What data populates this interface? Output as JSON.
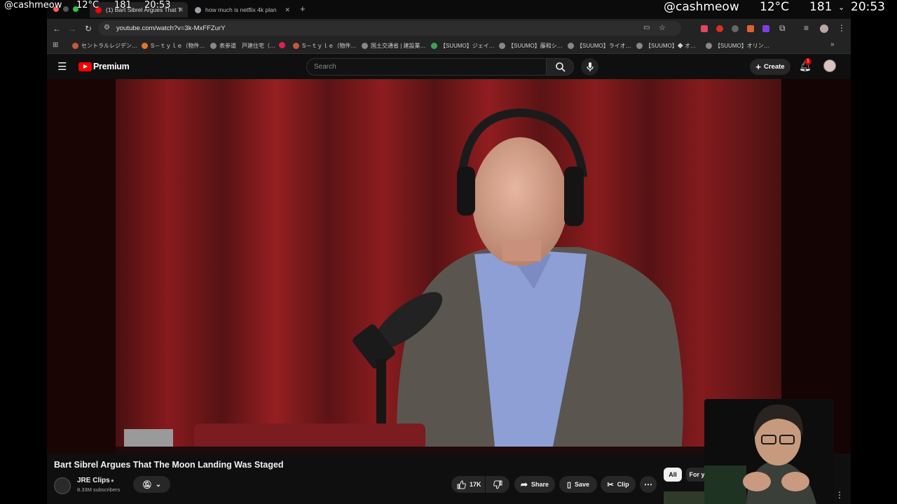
{
  "overlay": {
    "handle_left": "@cashmeow",
    "temp_left": "12°C",
    "count_left": "181",
    "time_left": "20:53",
    "handle_right": "@cashmeow",
    "temp_right": "12°C",
    "count_right": "181",
    "time_right": "20:53"
  },
  "tabs": [
    {
      "title": "(1) Bart Sibrel Argues That T",
      "active": true,
      "icon_color": "#ff0000"
    },
    {
      "title": "how much is netflix 4k plan",
      "active": false,
      "icon_color": "#9aa0a6"
    }
  ],
  "toolbar": {
    "url": "youtube.com/watch?v=3k-MxFFZurY"
  },
  "bookmarks": [
    {
      "label": "セントラルレジデン…",
      "icon_color": "#c05a3a"
    },
    {
      "label": "S－ｔｙｌｅ（物件…",
      "icon_color": "#e0762b"
    },
    {
      "label": "表参道　戸建住宅（…",
      "icon_color": "#888888"
    },
    {
      "label": "",
      "icon_color": "#e02050"
    },
    {
      "label": "S－ｔｙｌｅ（物件…",
      "icon_color": "#c05a3a"
    },
    {
      "label": "国土交通省 | 建設業…",
      "icon_color": "#888888"
    },
    {
      "label": "【SUUMO】ジェイ…",
      "icon_color": "#3fa34d"
    },
    {
      "label": "【SUUMO】藤和シ…",
      "icon_color": "#888888"
    },
    {
      "label": "【SUUMO】ライオ…",
      "icon_color": "#888888"
    },
    {
      "label": "【SUUMO】◆ オ…",
      "icon_color": "#888888"
    },
    {
      "label": "【SUUMO】オリン…",
      "icon_color": "#888888"
    }
  ],
  "youtube": {
    "logo_text": "Premium",
    "search_placeholder": "Search",
    "create_label": "Create",
    "notification_count": "1"
  },
  "video": {
    "title": "Bart Sibrel Argues That The Moon Landing Was Staged",
    "channel": "JRE Clips",
    "subscribers": "8.33M subscribers",
    "likes": "17K",
    "share_label": "Share",
    "save_label": "Save",
    "clip_label": "Clip"
  },
  "chips": {
    "all": "All",
    "for_you": "For you"
  },
  "icons": {
    "menu": "hamburger-menu-icon",
    "search": "search-icon",
    "mic": "microphone-icon",
    "bell": "bell-icon",
    "like": "thumbs-up-icon",
    "dislike": "thumbs-down-icon",
    "share": "share-arrow-icon",
    "save": "bookmark-icon",
    "clip": "scissors-icon",
    "more": "more-horizontal-icon"
  },
  "colors": {
    "youtube_red": "#ff0000",
    "background": "#0f0f0f",
    "chrome_toolbar": "#232323"
  }
}
